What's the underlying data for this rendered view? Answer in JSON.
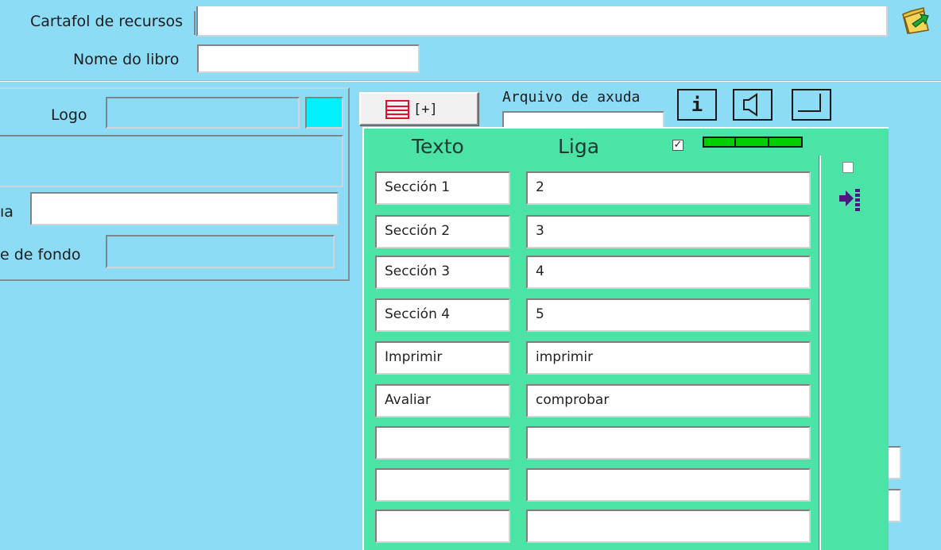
{
  "top": {
    "cartafol_label": "Cartafol de recursos",
    "cartafol_value": "",
    "nome_label": "Nome do libro",
    "nome_value": ""
  },
  "left": {
    "logo_label": "Logo",
    "logo_value": "",
    "row2_label_partial": "ıa",
    "row2_value": "",
    "row3_label_partial": "e de fondo",
    "row3_value": ""
  },
  "toolbar": {
    "add_button_label": "[+]",
    "help_file_label": "Arquivo de axuda",
    "help_file_value": "",
    "info_icon_glyph": "i"
  },
  "table": {
    "col_text": "Texto",
    "col_link": "Liga",
    "show_checked": true,
    "rows": [
      {
        "text": "Sección 1",
        "link": "2"
      },
      {
        "text": "Sección 2",
        "link": "3"
      },
      {
        "text": "Sección 3",
        "link": "4"
      },
      {
        "text": "Sección 4",
        "link": "5"
      },
      {
        "text": "Imprimir",
        "link": "imprimir"
      },
      {
        "text": "Avaliar",
        "link": "comprobar"
      },
      {
        "text": "",
        "link": ""
      },
      {
        "text": "",
        "link": ""
      },
      {
        "text": "",
        "link": ""
      }
    ]
  },
  "side": {
    "option_checked": false
  },
  "colors": {
    "background": "#8ddcf6",
    "panel": "#4be3a6",
    "accent_bar": "#00d000",
    "doc_icon": "#e0102a",
    "arrow_icon": "#4b1a80"
  }
}
